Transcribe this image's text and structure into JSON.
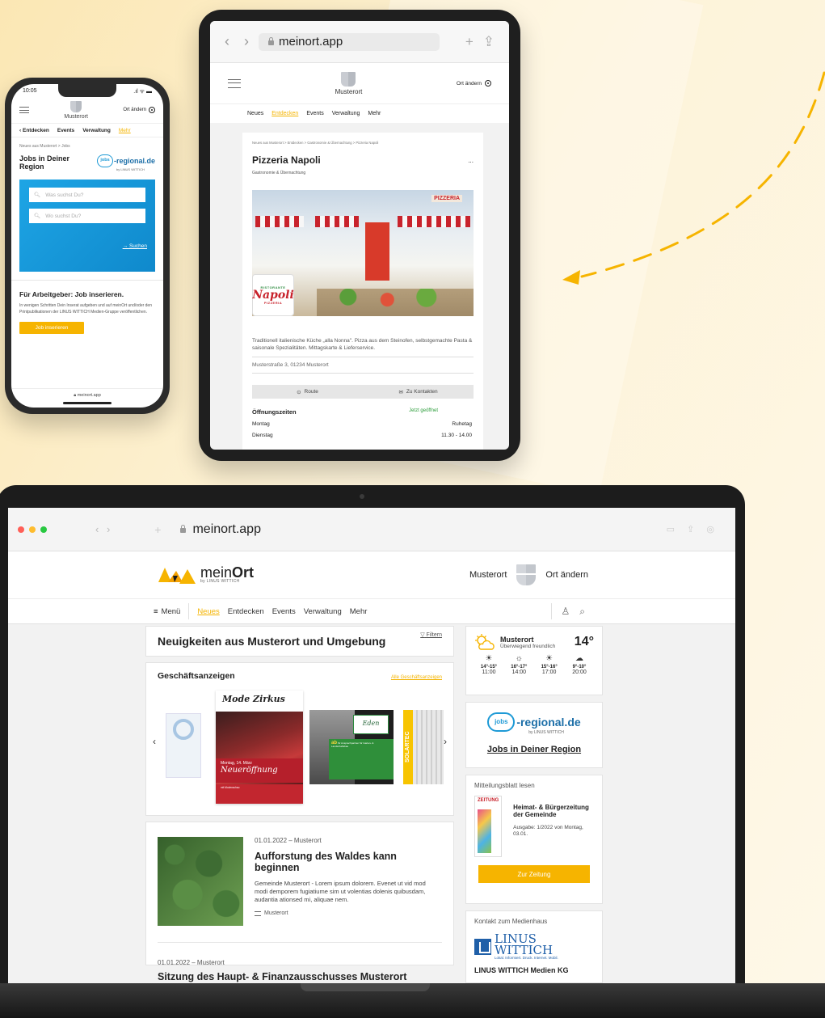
{
  "colors": {
    "accent": "#f6b400",
    "jobs_blue": "#1e9ad6",
    "brand_blue": "#1f5fa8"
  },
  "phone": {
    "time": "10:05",
    "status_icons": ".ıl ᯤ ▬",
    "town": "Musterort",
    "change_place": "Ort ändern",
    "nav": {
      "back": "Entdecken",
      "events": "Events",
      "admin": "Verwaltung",
      "more": "Mehr"
    },
    "breadcrumb": "Neues aus Musterort > Jobs",
    "jobs_title": "Jobs in Deiner Region",
    "jobs_logo_pin": "jobs",
    "jobs_logo_rest": "-regional.de",
    "jobs_by": "by LINUS WITTICH",
    "search_what": "Was suchst Du?",
    "search_where": "Wo suchst Du?",
    "search_link": "Suchen",
    "employer_title": "Für Arbeitgeber: Job inserieren.",
    "employer_text": "In wenigen Schritten Dein Inserat aufgeben und auf meinOrt und/oder den Printpublikationen der LINUS WITTICH Medien-Gruppe veröffentlichen.",
    "employer_button": "Job inserieren",
    "bottom_url": "meinort.app"
  },
  "tablet": {
    "url": "meinort.app",
    "town": "Musterort",
    "change_place": "Ort ändern",
    "nav": [
      "Neues",
      "Entdecken",
      "Events",
      "Verwaltung",
      "Mehr"
    ],
    "breadcrumb": "Neues aus Musterort > Entdecken > Gastronomie & Übernachtung > Pizzeria Napoli",
    "title": "Pizzeria Napoli",
    "more": "...",
    "category": "Gastronomie & Übernachtung",
    "sign": "PIZZERIA",
    "logo_top": "RISTORANTE",
    "logo_name": "Napoli",
    "logo_bottom": "PIZZERIA",
    "description": "Traditionell italienische Küche „alla Nonna\". Pizza aus dem Steinofen, selbstgemachte Pasta & saisonale Spezialitäten. Mittagskarte & Lieferservice.",
    "address": "Musterstraße 3, 01234 Musterort",
    "route_button": "Route",
    "contacts_button": "Zu Kontakten",
    "hours_title": "Öffnungszeiten",
    "hours_status": "Jetzt geöffnet",
    "hours": [
      {
        "day": "Montag",
        "time": "Ruhetag"
      },
      {
        "day": "Dienstag",
        "time": "11.30  - 14.00"
      }
    ]
  },
  "laptop": {
    "url": "meinort.app",
    "brand_prefix": "mein",
    "brand_suffix": "Ort",
    "brand_by": "by LINUS WITTICH",
    "town": "Musterort",
    "change_place": "Ort ändern",
    "nav": {
      "menu": "Menü",
      "news": "Neues",
      "discover": "Entdecken",
      "events": "Events",
      "admin": "Verwaltung",
      "more": "Mehr"
    },
    "news_title": "Neuigkeiten aus Musterort und Umgebung",
    "filter": "Filtern",
    "business_title": "Geschäftsanzeigen",
    "business_all": "Alle Geschäftsanzeigen",
    "ad_mode_title": "Mode Zirkus",
    "ad_mode_date": "Montag, 14. März",
    "ad_mode_headline": "Neueröffnung",
    "ad_mode_sub": "mit Modenschau",
    "ad_garden_brand": "Eden",
    "ad_garden_headline": "Ihr Ansprechpartner für Garten- & Landschaftsbau",
    "ad_solar": "SOLARTEC",
    "article1": {
      "date": "01.01.2022 – Musterort",
      "title": "Aufforstung des Waldes kann beginnen",
      "text": "Gemeinde Musterort - Lorem ipsum dolorem. Evenet ut vid mod modi demporem fugiatiume sim ut volentias dolenis quibusdam, audantia ationsed mi, aliquae nem.",
      "tag": "Musterort"
    },
    "article2": {
      "date": "01.01.2022 – Musterort",
      "title": "Sitzung des Haupt- & Finanzausschusses Musterort"
    },
    "weather": {
      "city": "Musterort",
      "summary": "Überwiegend freundlich",
      "temp": "14°",
      "forecast": [
        {
          "icon": "☀",
          "range": "14°-15°",
          "time": "11:00"
        },
        {
          "icon": "☼",
          "range": "16°-17°",
          "time": "14:00"
        },
        {
          "icon": "☀",
          "range": "15°-16°",
          "time": "17:00"
        },
        {
          "icon": "☁",
          "range": "9°-10°",
          "time": "20:00"
        }
      ]
    },
    "jobs": {
      "pin": "jobs",
      "rest": "-regional.de",
      "by": "by LINUS WITTICH",
      "link": "Jobs in Deiner Region"
    },
    "newsletter": {
      "heading": "Mitteilungsblatt lesen",
      "masthead": "ZEITUNG",
      "title": "Heimat- & Bürgerzeitung der Gemeinde",
      "issue": "Ausgabe: 1/2022 von Montag, 03.01.",
      "button": "Zur Zeitung"
    },
    "contact": {
      "heading": "Kontakt zum Medienhaus",
      "logo_name": "LINUS WITTICH",
      "logo_slogan": "Lokal. Informiert. Druck. Internet. Mobil.",
      "company": "LINUS WITTICH Medien KG"
    }
  }
}
